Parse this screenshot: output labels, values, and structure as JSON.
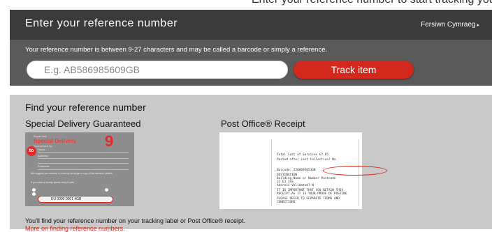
{
  "top_strip_text": "Enter your reference number to start tracking your item. The following will happen",
  "header": {
    "title": "Enter your reference number",
    "welsh_link": "Fersiwn Cymraeg",
    "welsh_arrow": "▸"
  },
  "search": {
    "hint": "Your reference number is between 9-27 characters and may be called a barcode or simply a reference.",
    "placeholder": "E.g. AB586985609GB",
    "button": "Track item"
  },
  "help": {
    "heading": "Find your reference number",
    "special_delivery_title": "Special Delivery Guaranteed",
    "receipt_title": "Post Office® Receipt",
    "footer": "You'll find your reference number on your tracking label or Post Office® receipt.",
    "more_link": "More on finding reference numbers."
  },
  "sdg_label": {
    "brand_small": "Royal Mail",
    "brand_name": "Special Delivery",
    "brand_sub": "Guaranteed by",
    "nine": "9",
    "to": "to",
    "name_label": "Name",
    "address_label": "Address",
    "postcode_label": "Postcode",
    "text1": "We suggest you enclose in a sturdy envelope a copy of the sender's details.",
    "text2": "If you need a receipt please keep it safe.",
    "barcode": "KU 0000 0001 4GB"
  },
  "receipt_lines": [
    "Total Cost of Services     £7.95",
    "Posted after Last Collection?   No",
    "Barcode:         ZJ08692053GB",
    "              DESTINATION",
    "Building Name or Number  Postcode",
    "21                       E3 3SS",
    "Address Validated?         N",
    "  IT IS IMPORTANT THAT YOU RETAIN THIS",
    "  RECEIPT AS IT IS YOUR PROOF OF POSTING",
    "  PLEASE REFER TO SEPARATE TERMS AND",
    "             CONDITIONS"
  ],
  "colors": {
    "header_bg": "#3b3b3b",
    "search_bg": "#5a5a5a",
    "accent_red": "#d3281c",
    "panel_bg": "#c9c9c9"
  }
}
